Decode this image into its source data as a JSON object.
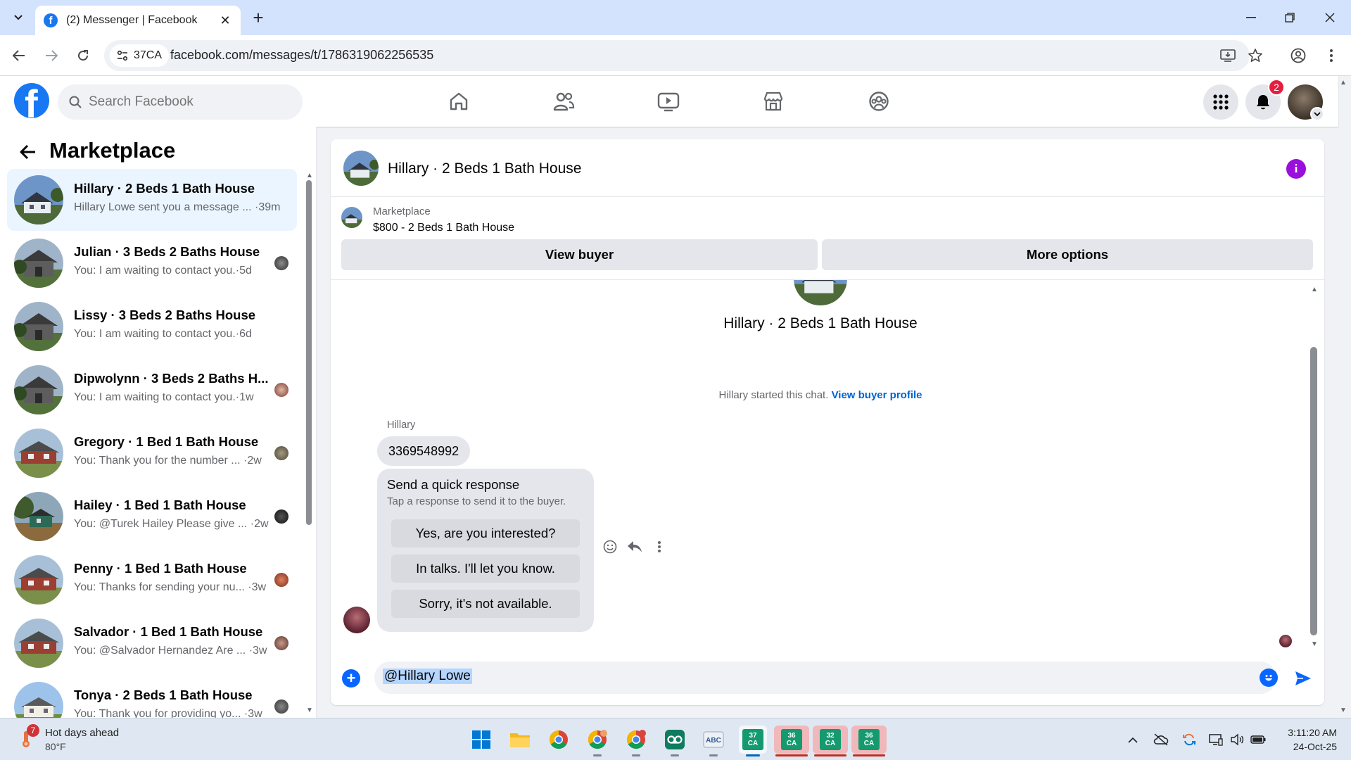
{
  "browser": {
    "tab_title": "(2) Messenger | Facebook",
    "tab_favicon": "facebook-favicon",
    "site_info_badge": "37CA",
    "url": "facebook.com/messages/t/1786319062256535"
  },
  "fb_header": {
    "search_placeholder": "Search Facebook",
    "notification_count": "2",
    "brand_color": "#1877f2"
  },
  "sidebar": {
    "title": "Marketplace",
    "conversations": [
      {
        "name": "Hillary · 2 Beds 1 Bath House",
        "snippet": "Hillary Lowe sent you a message ... ·39m",
        "active": true
      },
      {
        "name": "Julian · 3 Beds 2 Baths House",
        "snippet": "You: I am waiting to contact you.·5d"
      },
      {
        "name": "Lissy · 3 Beds 2 Baths House",
        "snippet": "You: I am waiting to contact you.·6d"
      },
      {
        "name": "Dipwolynn · 3 Beds 2 Baths H...",
        "snippet": "You: I am waiting to contact you.·1w"
      },
      {
        "name": "Gregory · 1 Bed 1 Bath House",
        "snippet": "You: Thank you for the number ... ·2w"
      },
      {
        "name": "Hailey · 1 Bed 1 Bath House",
        "snippet": "You: @Turek Hailey Please give ... ·2w"
      },
      {
        "name": "Penny · 1 Bed 1 Bath House",
        "snippet": "You: Thanks for sending your nu... ·3w"
      },
      {
        "name": "Salvador · 1 Bed 1 Bath House",
        "snippet": "You: @Salvador Hernandez Are ... ·3w"
      },
      {
        "name": "Tonya · 2 Beds 1 Bath House",
        "snippet": "You: Thank you for providing yo... ·3w"
      }
    ]
  },
  "chat": {
    "title": "Hillary · 2 Beds 1 Bath House",
    "marketplace_label": "Marketplace",
    "listing": "$800 - 2 Beds 1 Bath House",
    "view_buyer_label": "View buyer",
    "more_options_label": "More options",
    "body_title": "Hillary · 2 Beds 1 Bath House",
    "started_text": "Hillary started this chat.",
    "view_buyer_profile_label": "View buyer profile",
    "sender_name": "Hillary",
    "phone_message": "3369548992",
    "quick_title": "Send a quick response",
    "quick_subtitle": "Tap a response to send it to the buyer.",
    "quick_responses": [
      "Yes, are you interested?",
      "In talks. I'll let you know.",
      "Sorry, it's not available."
    ],
    "composer_value": "@Hillary Lowe",
    "accent_color": "#0866ff"
  },
  "taskbar": {
    "weather_badge": "7",
    "weather_title": "Hot days ahead",
    "weather_temp": "80°F",
    "time": "3:11:20 AM",
    "date": "24-Oct-25",
    "ca_tiles": [
      "37 CA",
      "36 CA",
      "32 CA",
      "36 CA"
    ]
  }
}
